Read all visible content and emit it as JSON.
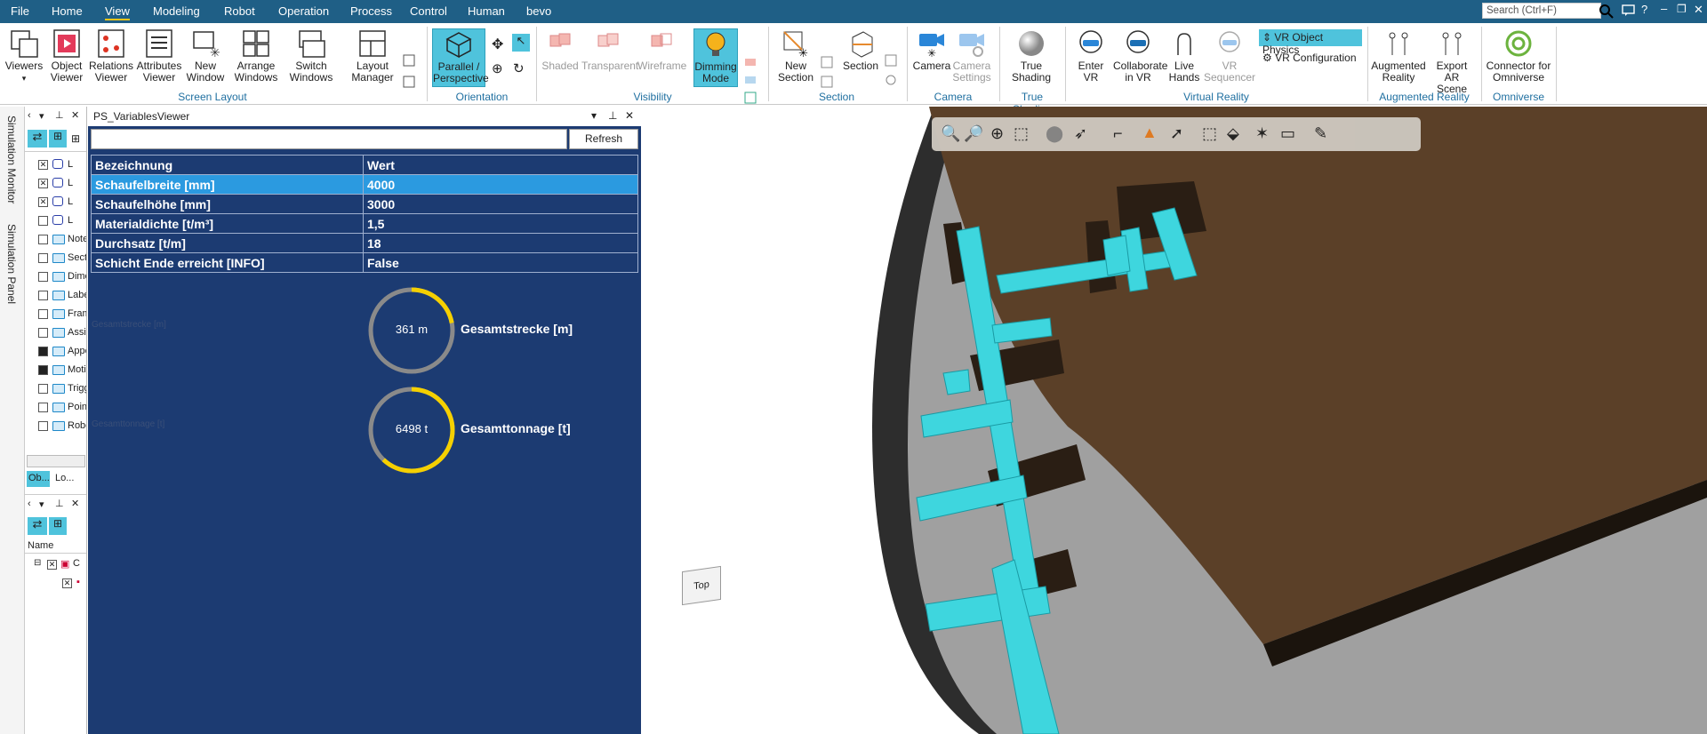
{
  "menubar": {
    "items": [
      "File",
      "Home",
      "View",
      "Modeling",
      "Robot",
      "Operation",
      "Process",
      "Control",
      "Human",
      "bevo"
    ],
    "active": "View",
    "search_placeholder": "Search (Ctrl+F)"
  },
  "ribbon": {
    "buttons": {
      "viewers": "Viewers",
      "object_viewer": "Object Viewer",
      "relations_viewer": "Relations Viewer",
      "attributes_viewer": "Attributes Viewer",
      "new_window": "New Window",
      "arrange_windows": "Arrange Windows",
      "switch_windows": "Switch Windows",
      "layout_manager": "Layout Manager",
      "parallel_perspective": "Parallel / Perspective",
      "shaded": "Shaded",
      "transparent": "Transparent",
      "wireframe": "Wireframe",
      "dimming_mode": "Dimming Mode",
      "new_section": "New Section",
      "section": "Section",
      "camera": "Camera",
      "camera_settings": "Camera Settings",
      "true_shading": "True Shading",
      "enter_vr": "Enter VR",
      "collaborate_vr": "Collaborate in VR",
      "live_hands": "Live Hands",
      "vr_sequencer": "VR Sequencer",
      "vr_object_physics": "VR Object Physics",
      "vr_configuration": "VR Configuration",
      "augmented_reality": "Augmented Reality",
      "export_ar_scene": "Export AR Scene",
      "connector_omniverse": "Connector for Omniverse"
    },
    "groups": {
      "screen_layout": "Screen Layout",
      "orientation": "Orientation",
      "visibility": "Visibility",
      "section": "Section",
      "camera": "Camera",
      "true_shading": "True Shading",
      "virtual_reality": "Virtual Reality",
      "augmented_reality": "Augmented Reality",
      "omniverse": "Omniverse"
    }
  },
  "side_tabs": {
    "simulation_monitor": "Simulation Monitor",
    "simulation_panel": "Simulation Panel"
  },
  "tree": {
    "rows": [
      "L",
      "L",
      "L",
      "L",
      "Note",
      "Sect",
      "Dime",
      "Labe",
      "Fram",
      "Assi",
      "Appe",
      "Motio",
      "Trigg",
      "Poin",
      "Robo"
    ],
    "tabs": [
      "Ob...",
      "Lo..."
    ],
    "name_header": "Name",
    "lower_rows": [
      "C",
      ""
    ]
  },
  "viewer": {
    "title": "PS_VariablesViewer",
    "refresh": "Refresh",
    "columns": [
      "Bezeichnung",
      "Wert"
    ],
    "rows": [
      {
        "name": "Schaufelbreite [mm]",
        "value": "4000"
      },
      {
        "name": "Schaufelhöhe [mm]",
        "value": "3000"
      },
      {
        "name": "Materialdichte [t/m³]",
        "value": "1,5"
      },
      {
        "name": "Durchsatz [t/m]",
        "value": "18"
      },
      {
        "name": "Schicht Ende erreicht [INFO]",
        "value": "False"
      }
    ],
    "gauges": [
      {
        "text": "361 m",
        "label": "Gesamtstrecke [m]",
        "faint": "Gesamtstrecke [m]",
        "fraction": 0.22
      },
      {
        "text": "6498 t",
        "label": "Gesamttonnage [t]",
        "faint": "Gesamttonnage [t]",
        "fraction": 0.62
      }
    ]
  },
  "scene": {
    "cube_label": "Top"
  },
  "colors": {
    "menubar": "#1f5f86",
    "panel": "#1c3b72",
    "selection": "#2b9ae0",
    "gauge_fill": "#f5d000",
    "cyan": "#3ed6de",
    "brown": "#5b4028"
  }
}
